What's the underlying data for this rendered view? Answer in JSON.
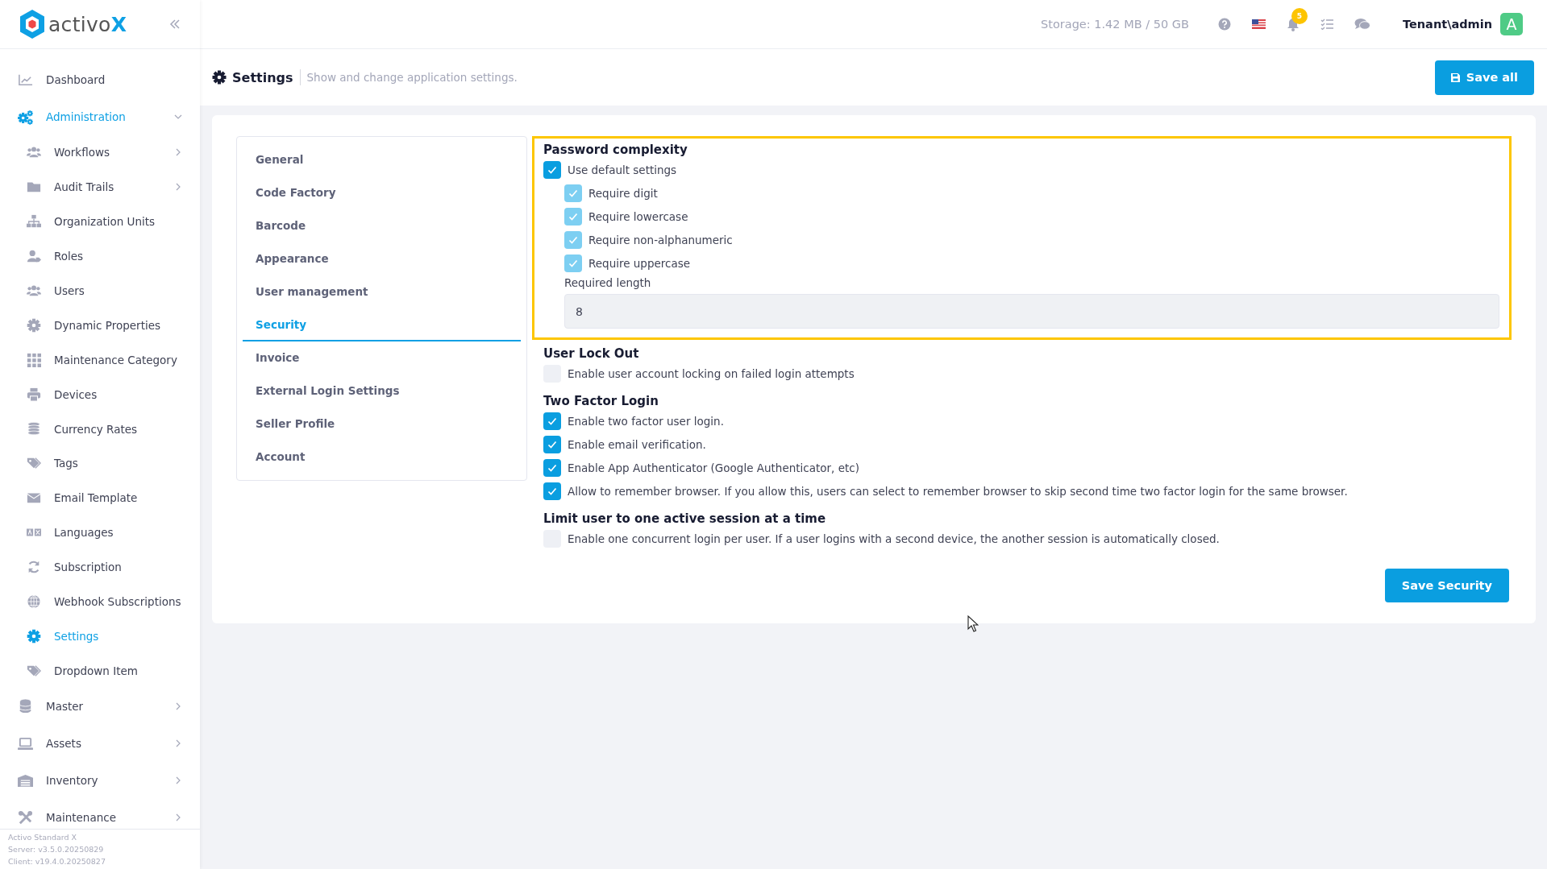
{
  "app": {
    "logo_text": "activo",
    "logo_accent": "X"
  },
  "sidebar": {
    "items": [
      {
        "label": "Dashboard",
        "selected": false,
        "expandable": false
      },
      {
        "label": "Administration",
        "selected": true,
        "expandable": true,
        "expanded": true,
        "children": [
          {
            "label": "Workflows",
            "selected": false,
            "expandable": true,
            "expanded": false
          },
          {
            "label": "Audit Trails",
            "selected": false,
            "expandable": true,
            "expanded": false
          },
          {
            "label": "Organization Units",
            "selected": false,
            "expandable": false
          },
          {
            "label": "Roles",
            "selected": false,
            "expandable": false
          },
          {
            "label": "Users",
            "selected": false,
            "expandable": false
          },
          {
            "label": "Dynamic Properties",
            "selected": false,
            "expandable": false
          },
          {
            "label": "Maintenance Category",
            "selected": false,
            "expandable": false
          },
          {
            "label": "Devices",
            "selected": false,
            "expandable": false
          },
          {
            "label": "Currency Rates",
            "selected": false,
            "expandable": false
          },
          {
            "label": "Tags",
            "selected": false,
            "expandable": false
          },
          {
            "label": "Email Template",
            "selected": false,
            "expandable": false
          },
          {
            "label": "Languages",
            "selected": false,
            "expandable": false
          },
          {
            "label": "Subscription",
            "selected": false,
            "expandable": false
          },
          {
            "label": "Webhook Subscriptions",
            "selected": false,
            "expandable": false
          },
          {
            "label": "Settings",
            "selected": true,
            "expandable": false
          },
          {
            "label": "Dropdown Item",
            "selected": false,
            "expandable": false
          }
        ]
      },
      {
        "label": "Master",
        "selected": false,
        "expandable": true,
        "expanded": false
      },
      {
        "label": "Assets",
        "selected": false,
        "expandable": true,
        "expanded": false
      },
      {
        "label": "Inventory",
        "selected": false,
        "expandable": true,
        "expanded": false
      },
      {
        "label": "Maintenance",
        "selected": false,
        "expandable": true,
        "expanded": false
      }
    ],
    "footer": [
      "Activo Standard X",
      "Server: v3.5.0.20250829",
      "Client: v19.4.0.20250827"
    ]
  },
  "top_bar": {
    "storage": "Storage: 1.42 MB / 50 GB",
    "notification_count": "5",
    "user": "Tenant\\admin",
    "avatar": "A"
  },
  "page_header": {
    "title": "Settings",
    "description": "Show and change application settings.",
    "save_all": "Save all"
  },
  "tabs": [
    {
      "label": "General",
      "selected": false
    },
    {
      "label": "Code Factory",
      "selected": false
    },
    {
      "label": "Barcode",
      "selected": false
    },
    {
      "label": "Appearance",
      "selected": false
    },
    {
      "label": "User management",
      "selected": false
    },
    {
      "label": "Security",
      "selected": true
    },
    {
      "label": "Invoice",
      "selected": false
    },
    {
      "label": "External Login Settings",
      "selected": false
    },
    {
      "label": "Seller Profile",
      "selected": false
    },
    {
      "label": "Account",
      "selected": false
    }
  ],
  "sections": [
    {
      "title": "Password complexity",
      "highlighted": true,
      "options": [
        {
          "label": "Use default settings",
          "checked": true,
          "disabled": false,
          "children": [
            {
              "label": "Require digit",
              "checked": true,
              "disabled": true
            },
            {
              "label": "Require lowercase",
              "checked": true,
              "disabled": true
            },
            {
              "label": "Require non-alphanumeric",
              "checked": true,
              "disabled": true
            },
            {
              "label": "Require uppercase",
              "checked": true,
              "disabled": true
            }
          ]
        }
      ],
      "field": {
        "label": "Required length",
        "value": "8",
        "disabled": true
      }
    },
    {
      "title": "User Lock Out",
      "highlighted": false,
      "options": [
        {
          "label": "Enable user account locking on failed login attempts",
          "checked": false,
          "disabled": false
        }
      ]
    },
    {
      "title": "Two Factor Login",
      "highlighted": false,
      "options": [
        {
          "label": "Enable two factor user login.",
          "checked": true,
          "disabled": false
        },
        {
          "label": "Enable email verification.",
          "checked": true,
          "disabled": false
        },
        {
          "label": "Enable App Authenticator (Google Authenticator, etc)",
          "checked": true,
          "disabled": false
        },
        {
          "label": "Allow to remember browser. If you allow this, users can select to remember browser to skip second time two factor login for the same browser.",
          "checked": true,
          "disabled": false
        }
      ]
    },
    {
      "title": "Limit user to one active session at a time",
      "highlighted": false,
      "options": [
        {
          "label": "Enable one concurrent login per user. If a user logins with a second device, the another session is automatically closed.",
          "checked": false,
          "disabled": false
        }
      ]
    }
  ],
  "save_button": "Save Security"
}
